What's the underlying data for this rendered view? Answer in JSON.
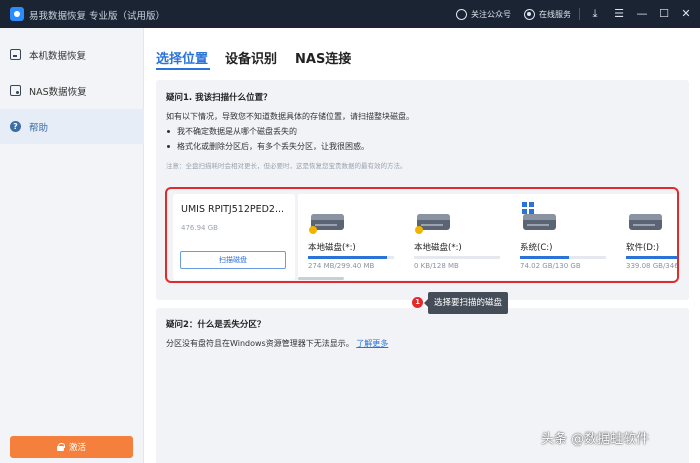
{
  "titlebar": {
    "title": "易我数据恢复 专业版（试用版）",
    "follow_label": "关注公众号",
    "support_label": "在线服务",
    "download_symbol": "⤓",
    "menu_symbol": "☰",
    "minimize_symbol": "—",
    "maximize_symbol": "☐",
    "close_symbol": "✕"
  },
  "sidebar": {
    "items": [
      {
        "label": "本机数据恢复",
        "icon": "drive-icon"
      },
      {
        "label": "NAS数据恢复",
        "icon": "nas-icon"
      },
      {
        "label": "帮助",
        "icon": "help-icon",
        "active": true
      }
    ],
    "help_glyph": "?",
    "activate_label": "激活"
  },
  "tabs": [
    {
      "label": "选择位置",
      "active": true
    },
    {
      "label": "设备识别"
    },
    {
      "label": "NAS连接"
    }
  ],
  "faq1": {
    "title": "疑问1. 我该扫描什么位置？",
    "intro": "如有以下情况，导致您不知道数据具体的存储位置，请扫描整块磁盘。",
    "bullets": [
      "我不确定数据是从哪个磁盘丢失的",
      "格式化或删除分区后，有多个丢失分区，让我很困惑。"
    ],
    "note": "注意：全盘扫描耗时会相对更长，但必要时，这是恢复您宝贵数据的最有效的方法。"
  },
  "disk": {
    "name": "UMIS RPITJ512PED2...",
    "size": "476.94 GB",
    "scan_button": "扫描磁盘"
  },
  "partitions": [
    {
      "label": "本地磁盘(*:)",
      "size": "274 MB/299.40 MB",
      "used_fraction": 0.92,
      "locked": true
    },
    {
      "label": "本地磁盘(*:)",
      "size": "0 KB/128 MB",
      "used_fraction": 0.0,
      "locked": true
    },
    {
      "label": "系统(C:)",
      "size": "74.02 GB/130 GB",
      "used_fraction": 0.57,
      "windows": true
    },
    {
      "label": "软件(D:)",
      "size": "339.08 GB/346",
      "used_fraction": 0.98
    }
  ],
  "callout": {
    "number": "1",
    "text": "选择要扫描的磁盘"
  },
  "faq2": {
    "title": "疑问2：什么是丢失分区？",
    "text": "分区没有盘符且在Windows资源管理器下无法显示。",
    "link": "了解更多"
  },
  "watermark": "头条 @数据蛙软件",
  "colors": {
    "accent": "#2b72d9",
    "titlebar": "#1a2433",
    "highlight": "#e22a2a",
    "activate": "#f5803e"
  }
}
